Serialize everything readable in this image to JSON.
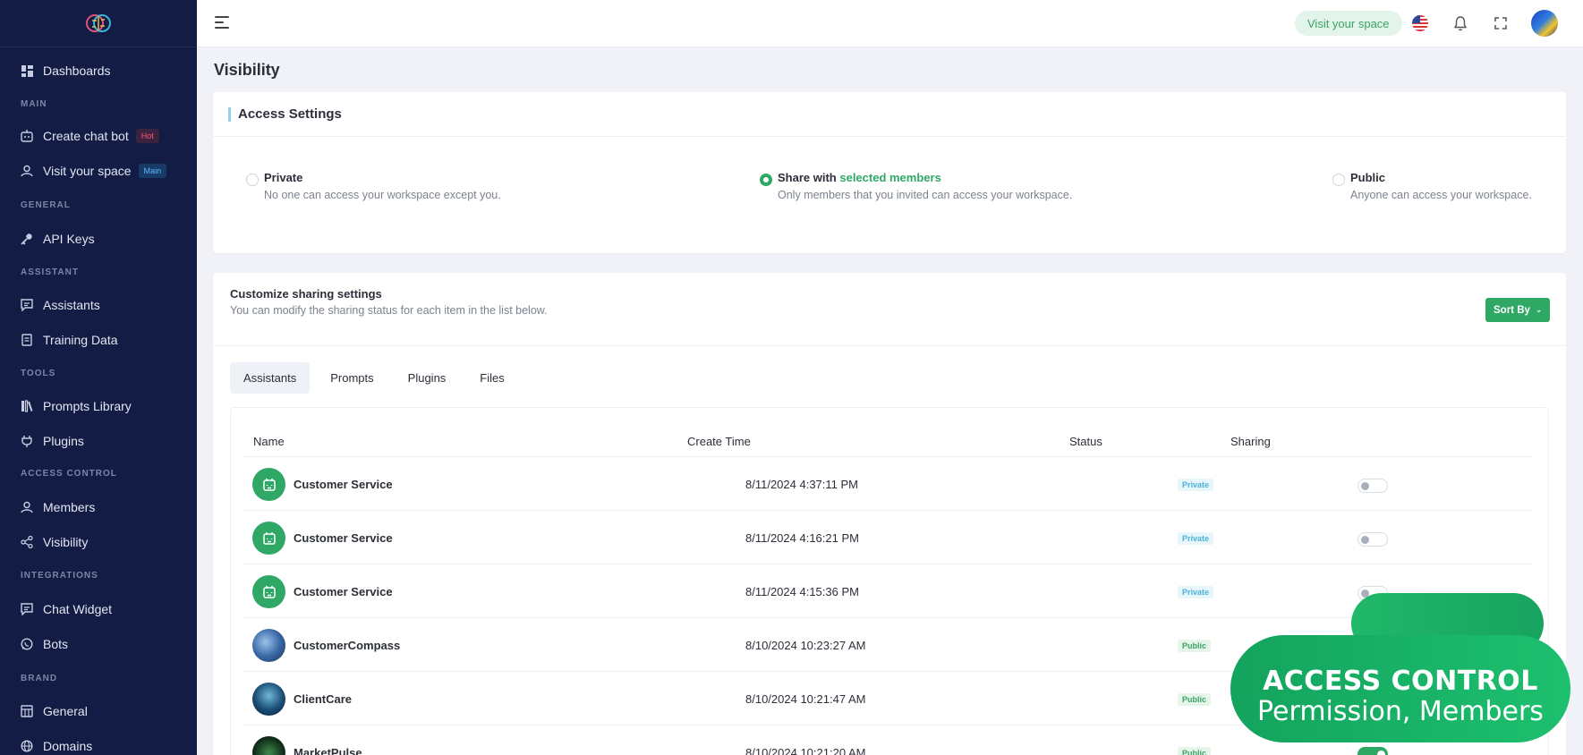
{
  "sidebar": {
    "logo": "brain-logo",
    "sections": {
      "main": "MAIN",
      "general": "GENERAL",
      "assistant": "ASSISTANT",
      "tools": "TOOLS",
      "access_control": "ACCESS CONTROL",
      "integrations": "INTEGRATIONS",
      "brand": "BRAND"
    },
    "items": {
      "dashboards": "Dashboards",
      "create_chat_bot": "Create chat bot",
      "create_chat_bot_badge": "Hot",
      "visit_your_space": "Visit your space",
      "visit_your_space_badge": "Main",
      "api_keys": "API Keys",
      "assistants": "Assistants",
      "training_data": "Training Data",
      "prompts_library": "Prompts Library",
      "plugins": "Plugins",
      "members": "Members",
      "visibility": "Visibility",
      "chat_widget": "Chat Widget",
      "bots": "Bots",
      "general": "General",
      "domains": "Domains"
    }
  },
  "topbar": {
    "visit_button": "Visit your space",
    "language_flag": "us-flag-icon"
  },
  "page": {
    "title": "Visibility"
  },
  "access_settings": {
    "title": "Access Settings",
    "options": [
      {
        "title": "Private",
        "title_highlight": "",
        "desc": "No one can access your workspace except you.",
        "checked": false
      },
      {
        "title": "Share with ",
        "title_highlight": "selected members",
        "desc": "Only members that you invited can access your workspace.",
        "checked": true
      },
      {
        "title": "Public",
        "title_highlight": "",
        "desc": "Anyone can access your workspace.",
        "checked": false
      }
    ]
  },
  "sharing": {
    "title": "Customize sharing settings",
    "desc": "You can modify the sharing status for each item in the list below.",
    "sort_button": "Sort By",
    "tabs": [
      "Assistants",
      "Prompts",
      "Plugins",
      "Files"
    ],
    "active_tab": "Assistants",
    "columns": [
      "Name",
      "Create Time",
      "Status",
      "Sharing"
    ],
    "rows": [
      {
        "name": "Customer Service",
        "time": "8/11/2024 4:37:11 PM",
        "status": "Private",
        "sharing": false,
        "avatar": "bot-icon"
      },
      {
        "name": "Customer Service",
        "time": "8/11/2024 4:16:21 PM",
        "status": "Private",
        "sharing": false,
        "avatar": "bot-icon"
      },
      {
        "name": "Customer Service",
        "time": "8/11/2024 4:15:36 PM",
        "status": "Private",
        "sharing": false,
        "avatar": "bot-icon"
      },
      {
        "name": "CustomerCompass",
        "time": "8/10/2024 10:23:27 AM",
        "status": "Public",
        "sharing": true,
        "avatar": "photo"
      },
      {
        "name": "ClientCare",
        "time": "8/10/2024 10:21:47 AM",
        "status": "Public",
        "sharing": true,
        "avatar": "photo"
      },
      {
        "name": "MarketPulse",
        "time": "8/10/2024 10:21:20 AM",
        "status": "Public",
        "sharing": true,
        "avatar": "photo"
      }
    ]
  },
  "promo": {
    "line1": "ACCESS CONTROL",
    "line2": "Permission, Members"
  },
  "colors": {
    "sidebar_bg": "#131c44",
    "accent_green": "#2fa866",
    "page_bg": "#f0f2f7"
  }
}
